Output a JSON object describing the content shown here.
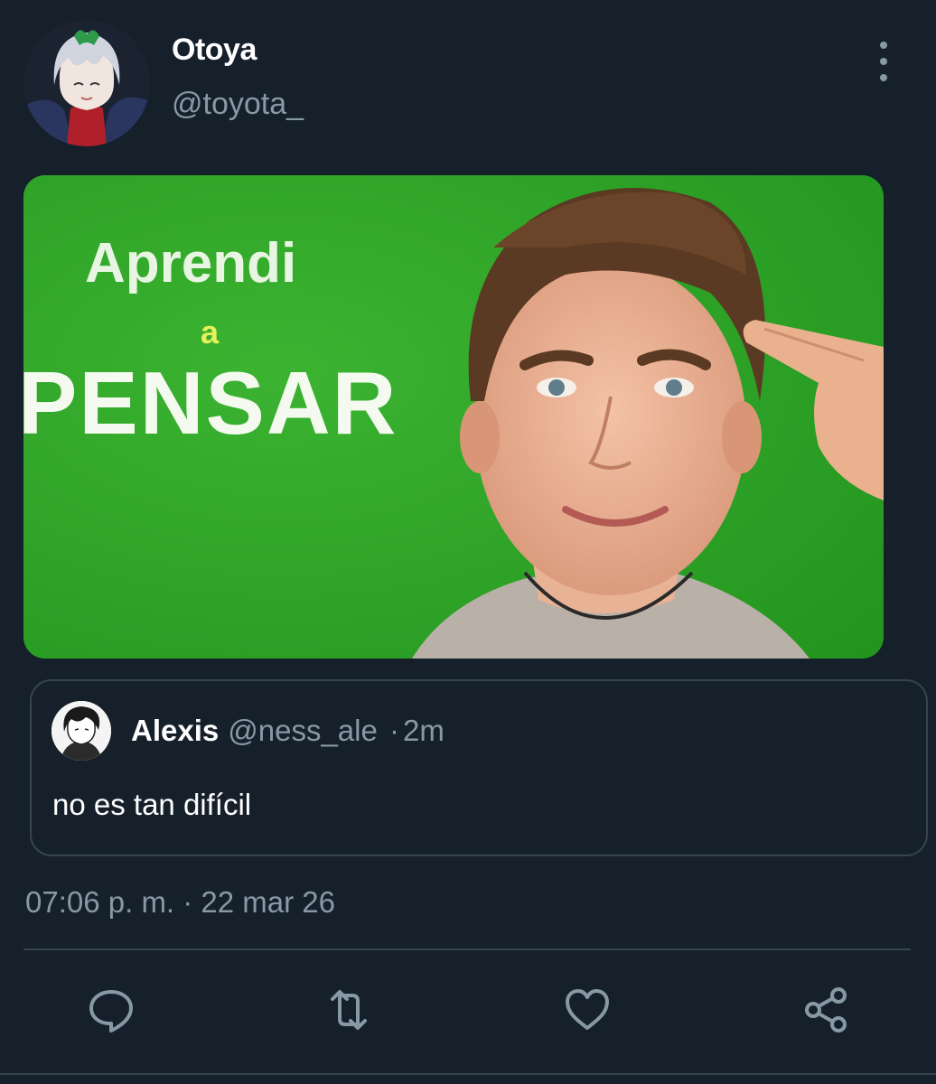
{
  "tweet": {
    "author": {
      "display_name": "Otoya",
      "handle": "@toyota_"
    },
    "media": {
      "text_line1": "Aprendi",
      "text_line2": "a",
      "text_line3": "PENSAR",
      "background_color": "#2fa32a"
    },
    "quoted": {
      "display_name": "Alexis",
      "handle": "@ness_ale",
      "separator": "·",
      "time": "2m",
      "text": "no es tan difícil"
    },
    "timestamp": "07:06 p. m. · 22 mar 26"
  },
  "actions": [
    {
      "icon": "reply-icon"
    },
    {
      "icon": "retweet-icon"
    },
    {
      "icon": "like-icon"
    },
    {
      "icon": "share-icon"
    }
  ],
  "colors": {
    "background": "#15202b",
    "secondary_text": "#8899a6",
    "border": "#38444d"
  }
}
